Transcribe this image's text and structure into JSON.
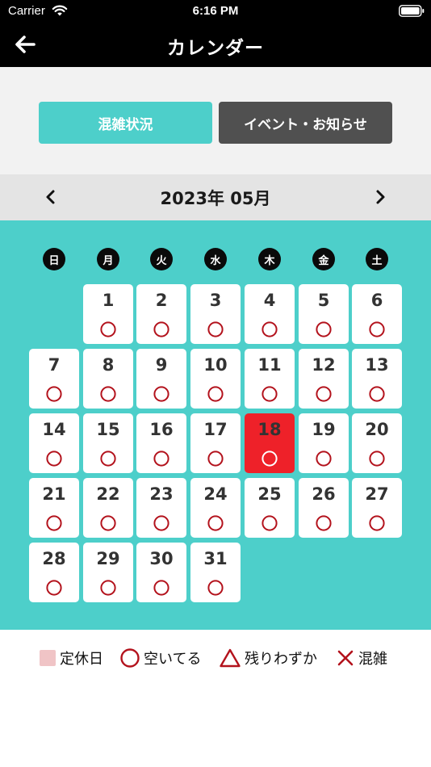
{
  "status_bar": {
    "carrier": "Carrier",
    "time": "6:16 PM"
  },
  "nav": {
    "title": "カレンダー",
    "back_icon": "back-arrow-icon"
  },
  "tabs": [
    {
      "label": "混雑状況",
      "active": true
    },
    {
      "label": "イベント・お知らせ",
      "active": false
    }
  ],
  "month": {
    "title": "2023年 05月",
    "prev_icon": "chevron-left-icon",
    "next_icon": "chevron-right-icon"
  },
  "weekdays": [
    "日",
    "月",
    "火",
    "水",
    "木",
    "金",
    "土"
  ],
  "days": [
    {
      "day": "1",
      "status": "open"
    },
    {
      "day": "2",
      "status": "open"
    },
    {
      "day": "3",
      "status": "open"
    },
    {
      "day": "4",
      "status": "open"
    },
    {
      "day": "5",
      "status": "open"
    },
    {
      "day": "6",
      "status": "open"
    },
    {
      "day": "7",
      "status": "open"
    },
    {
      "day": "8",
      "status": "open"
    },
    {
      "day": "9",
      "status": "open"
    },
    {
      "day": "10",
      "status": "open"
    },
    {
      "day": "11",
      "status": "open"
    },
    {
      "day": "12",
      "status": "open"
    },
    {
      "day": "13",
      "status": "open"
    },
    {
      "day": "14",
      "status": "open"
    },
    {
      "day": "15",
      "status": "open"
    },
    {
      "day": "16",
      "status": "open"
    },
    {
      "day": "17",
      "status": "open"
    },
    {
      "day": "18",
      "status": "open",
      "today": true
    },
    {
      "day": "19",
      "status": "open"
    },
    {
      "day": "20",
      "status": "open"
    },
    {
      "day": "21",
      "status": "open"
    },
    {
      "day": "22",
      "status": "open"
    },
    {
      "day": "23",
      "status": "open"
    },
    {
      "day": "24",
      "status": "open"
    },
    {
      "day": "25",
      "status": "open"
    },
    {
      "day": "26",
      "status": "open"
    },
    {
      "day": "27",
      "status": "open"
    },
    {
      "day": "28",
      "status": "open"
    },
    {
      "day": "29",
      "status": "open"
    },
    {
      "day": "30",
      "status": "open"
    },
    {
      "day": "31",
      "status": "open"
    }
  ],
  "first_weekday": 1,
  "legend": {
    "closed": "定休日",
    "open": "空いてる",
    "few": "残りわずか",
    "crowded": "混雑"
  },
  "colors": {
    "accent": "#4dcfca",
    "today": "#ee2129",
    "mark": "#b3121c",
    "closed": "#f0c4c6"
  }
}
